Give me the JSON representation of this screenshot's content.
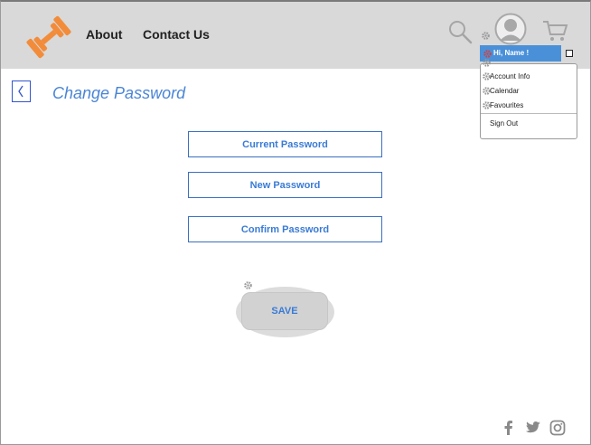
{
  "header": {
    "nav": [
      {
        "label": "About"
      },
      {
        "label": "Contact Us"
      }
    ],
    "logo_icon": "dumbbell-icon",
    "icons": [
      "search-icon",
      "user-avatar-icon",
      "cart-icon"
    ],
    "greeting": "Hi, Name !",
    "brand_color": "#f28c3a",
    "header_bg": "#d9d9d9"
  },
  "user_menu": {
    "items": [
      {
        "label": "Account Info"
      },
      {
        "label": "Calendar"
      },
      {
        "label": "Favourites"
      }
    ],
    "sign_out": "Sign Out"
  },
  "page": {
    "title": "Change Password",
    "back_icon": "chevron-left-icon",
    "accent_color": "#4a85d6"
  },
  "form": {
    "current_password": "Current Password",
    "new_password": "New Password",
    "confirm_password": "Confirm Password",
    "save_label": "SAVE"
  },
  "footer": {
    "social_icons": [
      "facebook-icon",
      "twitter-icon",
      "instagram-icon"
    ]
  }
}
